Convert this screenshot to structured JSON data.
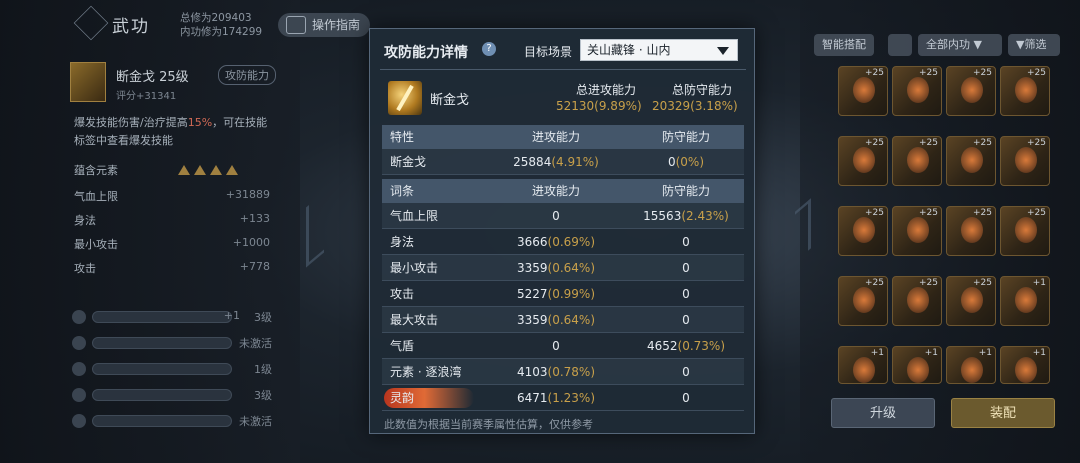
{
  "header": {
    "title": "武功",
    "total_cultivation": "总修为209403",
    "inner_cultivation": "内功修为174299",
    "guide_label": "操作指南"
  },
  "left_panel": {
    "skill_name": "断金戈 25级",
    "skill_tag": "攻防能力",
    "skill_score": "评分+31341",
    "desc_part1": "爆发技能伤害/治疗提高",
    "desc_highlight": "15%",
    "desc_part2": "，可在技能标签中查看爆发技能",
    "elements_label": "蕴含元素",
    "attributes": [
      {
        "name": "气血上限",
        "value": "+31889"
      },
      {
        "name": "身法",
        "value": "+133"
      },
      {
        "name": "最小攻击",
        "value": "+1000"
      },
      {
        "name": "攻击",
        "value": "+778"
      }
    ],
    "slots": [
      {
        "level": "3级",
        "plus": "+1"
      },
      {
        "level": "未激活",
        "plus": ""
      },
      {
        "level": "1级",
        "plus": ""
      },
      {
        "level": "3级",
        "plus": ""
      },
      {
        "level": "未激活",
        "plus": ""
      }
    ]
  },
  "right_panel": {
    "smart_match": "智能搭配",
    "filter_dropdown": "全部内功",
    "filter_label": "筛选",
    "inventory_badges": [
      "+25",
      "+25",
      "+25",
      "+25",
      "+25",
      "+25",
      "+25",
      "+25",
      "+25",
      "+25",
      "+25",
      "+25",
      "+25",
      "+25",
      "+25",
      "+1",
      "+1",
      "+1",
      "+1",
      "+1"
    ],
    "upgrade_label": "升级",
    "equip_label": "装配"
  },
  "dialog": {
    "title": "攻防能力详情",
    "help": "?",
    "scene_label": "目标场景",
    "scene_value": "关山藏锋 · 山内",
    "skill_name": "断金戈",
    "total_attack_label": "总进攻能力",
    "total_attack_value": "52130(9.89%)",
    "total_defense_label": "总防守能力",
    "total_defense_value": "20329(3.18%)",
    "trait_header": {
      "c1": "特性",
      "c2": "进攻能力",
      "c3": "防守能力"
    },
    "trait_row": {
      "name": "断金戈",
      "atk": "25884",
      "atk_pct": "(4.91%)",
      "def": "0",
      "def_pct": "(0%)"
    },
    "entry_header": {
      "c1": "词条",
      "c2": "进攻能力",
      "c3": "防守能力"
    },
    "entries": [
      {
        "name": "气血上限",
        "atk": "0",
        "atk_pct": "",
        "def": "15563",
        "def_pct": "(2.43%)"
      },
      {
        "name": "身法",
        "atk": "3666",
        "atk_pct": "(0.69%)",
        "def": "0",
        "def_pct": ""
      },
      {
        "name": "最小攻击",
        "atk": "3359",
        "atk_pct": "(0.64%)",
        "def": "0",
        "def_pct": ""
      },
      {
        "name": "攻击",
        "atk": "5227",
        "atk_pct": "(0.99%)",
        "def": "0",
        "def_pct": ""
      },
      {
        "name": "最大攻击",
        "atk": "3359",
        "atk_pct": "(0.64%)",
        "def": "0",
        "def_pct": ""
      },
      {
        "name": "气盾",
        "atk": "0",
        "atk_pct": "",
        "def": "4652",
        "def_pct": "(0.73%)"
      },
      {
        "name": "元素 · 逐浪湾",
        "atk": "4103",
        "atk_pct": "(0.78%)",
        "def": "0",
        "def_pct": ""
      },
      {
        "name": "灵韵",
        "atk": "6471",
        "atk_pct": "(1.23%)",
        "def": "0",
        "def_pct": ""
      }
    ],
    "note": "此数值为根据当前赛季属性估算，仅供参考"
  }
}
